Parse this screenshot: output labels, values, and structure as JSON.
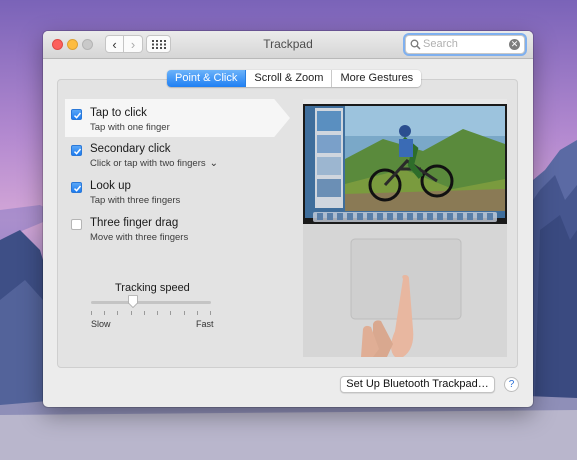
{
  "window": {
    "title": "Trackpad"
  },
  "toolbar": {
    "back_glyph": "‹",
    "forward_glyph": "›"
  },
  "search": {
    "placeholder": "Search",
    "clear_glyph": "✕"
  },
  "tabs": [
    {
      "label": "Point & Click",
      "active": true
    },
    {
      "label": "Scroll & Zoom",
      "active": false
    },
    {
      "label": "More Gestures",
      "active": false
    }
  ],
  "options": [
    {
      "title": "Tap to click",
      "subtitle": "Tap with one finger",
      "checked": true
    },
    {
      "title": "Secondary click",
      "subtitle": "Click or tap with two fingers",
      "checked": true,
      "dropdown": "⌄"
    },
    {
      "title": "Look up",
      "subtitle": "Tap with three fingers",
      "checked": true
    },
    {
      "title": "Three finger drag",
      "subtitle": "Move with three fingers",
      "checked": false
    }
  ],
  "tracking": {
    "label": "Tracking speed",
    "min_label": "Slow",
    "max_label": "Fast",
    "value_fraction": 0.35,
    "tick_count": 10
  },
  "footer": {
    "bluetooth_button": "Set Up Bluetooth Trackpad…",
    "help_glyph": "?"
  },
  "icons": {
    "search": "search-icon",
    "grid": "grid-icon",
    "checkmark": "checkmark-icon",
    "help": "help-icon"
  },
  "colors": {
    "accent": "#1f7ff3",
    "close": "#fc605c",
    "minimize": "#fdbc40",
    "zoom_disabled": "#c9c9c9"
  }
}
